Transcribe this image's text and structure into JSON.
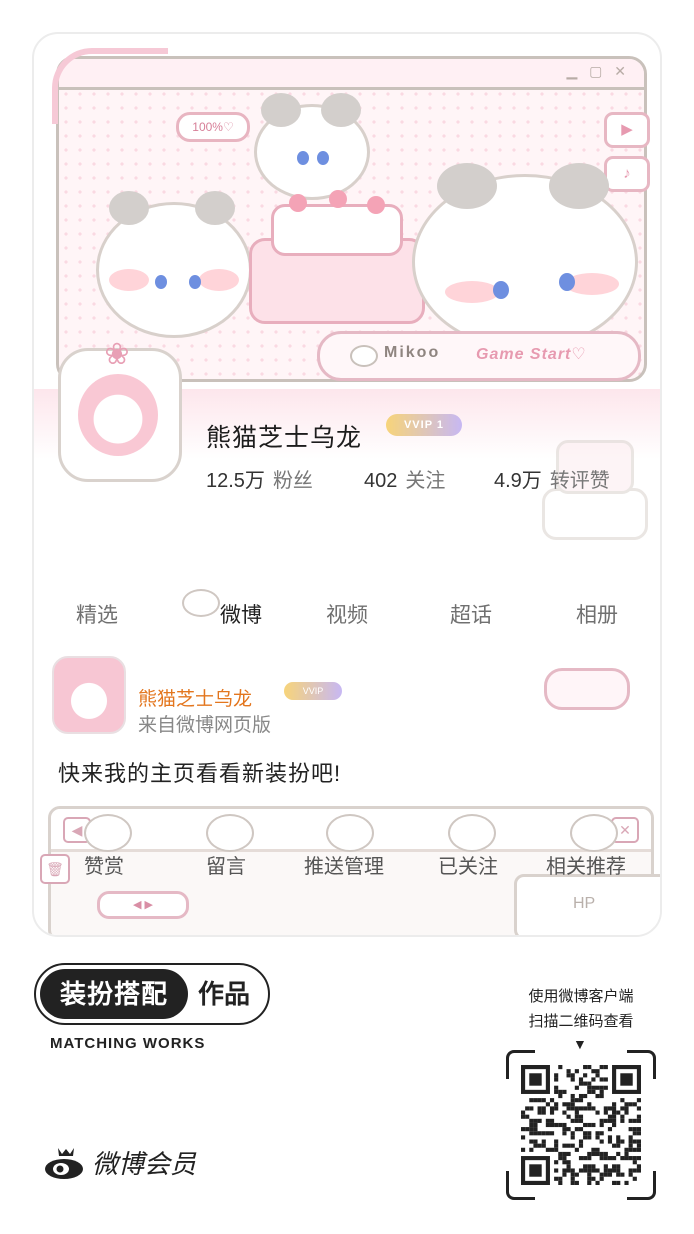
{
  "profile": {
    "name": "熊猫芝士乌龙",
    "vip_badge": "VVIP 1",
    "stats": [
      {
        "value": "12.5万",
        "label": "粉丝"
      },
      {
        "value": "402",
        "label": "关注"
      },
      {
        "value": "4.9万",
        "label": "转评赞"
      }
    ]
  },
  "header_art": {
    "percent_pill": "100%♡",
    "game_bar_name": "Mikoo",
    "game_bar_action": "Game Start♡",
    "window_controls": "▁ ▢ ✕"
  },
  "tabs": [
    {
      "label": "精选",
      "active": false
    },
    {
      "label": "微博",
      "active": true
    },
    {
      "label": "视频",
      "active": false
    },
    {
      "label": "超话",
      "active": false
    },
    {
      "label": "相册",
      "active": false
    }
  ],
  "post": {
    "author": "熊猫芝士乌龙",
    "source": "来自微博网页版",
    "text": "快来我的主页看看新装扮吧!"
  },
  "actions": [
    {
      "label": "赞赏"
    },
    {
      "label": "留言"
    },
    {
      "label": "推送管理"
    },
    {
      "label": "已关注"
    },
    {
      "label": "相关推荐"
    }
  ],
  "action_frame": {
    "pager": "◀ ▶",
    "hp_label": "HP"
  },
  "footer": {
    "badge_dark": "装扮搭配",
    "badge_light": "作品",
    "subtitle": "MATCHING WORKS",
    "brand": "微博会员",
    "qr_hint_line1": "使用微博客户端",
    "qr_hint_line2": "扫描二维码查看"
  },
  "colors": {
    "accent_pink": "#e79ab0",
    "name_orange": "#e3761e",
    "frame_gray": "#c9c1bb"
  }
}
